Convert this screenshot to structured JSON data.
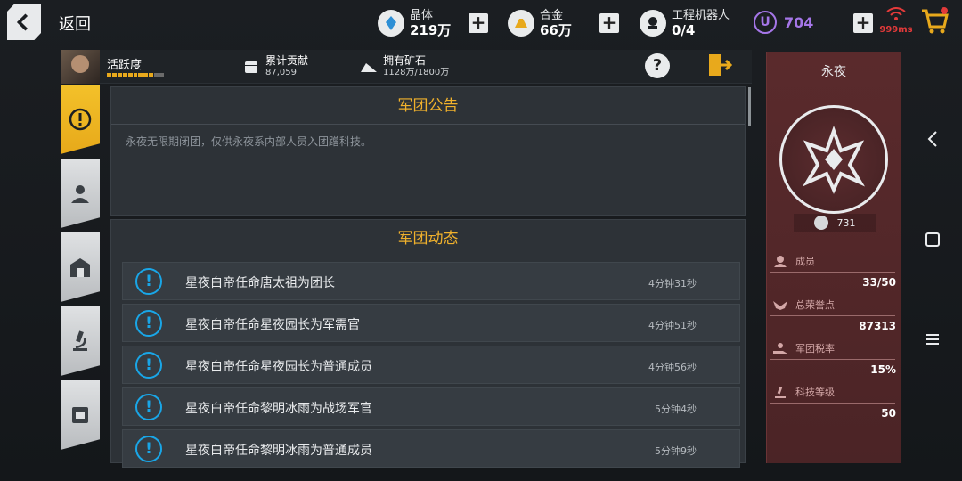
{
  "topbar": {
    "back_label": "返回",
    "crystal": {
      "label": "晶体",
      "value": "219万"
    },
    "alloy": {
      "label": "合金",
      "value": "66万"
    },
    "robot": {
      "label": "工程机器人",
      "value": "0/4"
    },
    "u_value": "704",
    "ping": "999ms"
  },
  "infobar": {
    "activity_label": "活跃度",
    "activity_level": 0.85,
    "contribution": {
      "label": "累计贡献",
      "value": "87,059"
    },
    "ore": {
      "label": "拥有矿石",
      "value": "1128万/1800万"
    }
  },
  "notice": {
    "title": "军团公告",
    "text": "永夜无限期闭团，仅供永夜系内部人员入团蹭科技。"
  },
  "feed": {
    "title": "军团动态",
    "items": [
      {
        "message": "星夜白帝任命唐太祖为团长",
        "time": "4分钟31秒"
      },
      {
        "message": "星夜白帝任命星夜园长为军需官",
        "time": "4分钟51秒"
      },
      {
        "message": "星夜白帝任命星夜园长为普通成员",
        "time": "4分钟56秒"
      },
      {
        "message": "星夜白帝任命黎明冰雨为战场军官",
        "time": "5分钟4秒"
      },
      {
        "message": "星夜白帝任命黎明冰雨为普通成员",
        "time": "5分钟9秒"
      }
    ]
  },
  "guild": {
    "name": "永夜",
    "coins": "731",
    "members_label": "成员",
    "members_value": "33/50",
    "honor_label": "总荣誉点",
    "honor_value": "87313",
    "tax_label": "军团税率",
    "tax_value": "15%",
    "tech_label": "科技等级",
    "tech_value": "50"
  },
  "colors": {
    "accent": "#f0b12c",
    "info_blue": "#19a6e7",
    "guild_red": "#5a2a2c",
    "u_purple": "#a576e8"
  }
}
